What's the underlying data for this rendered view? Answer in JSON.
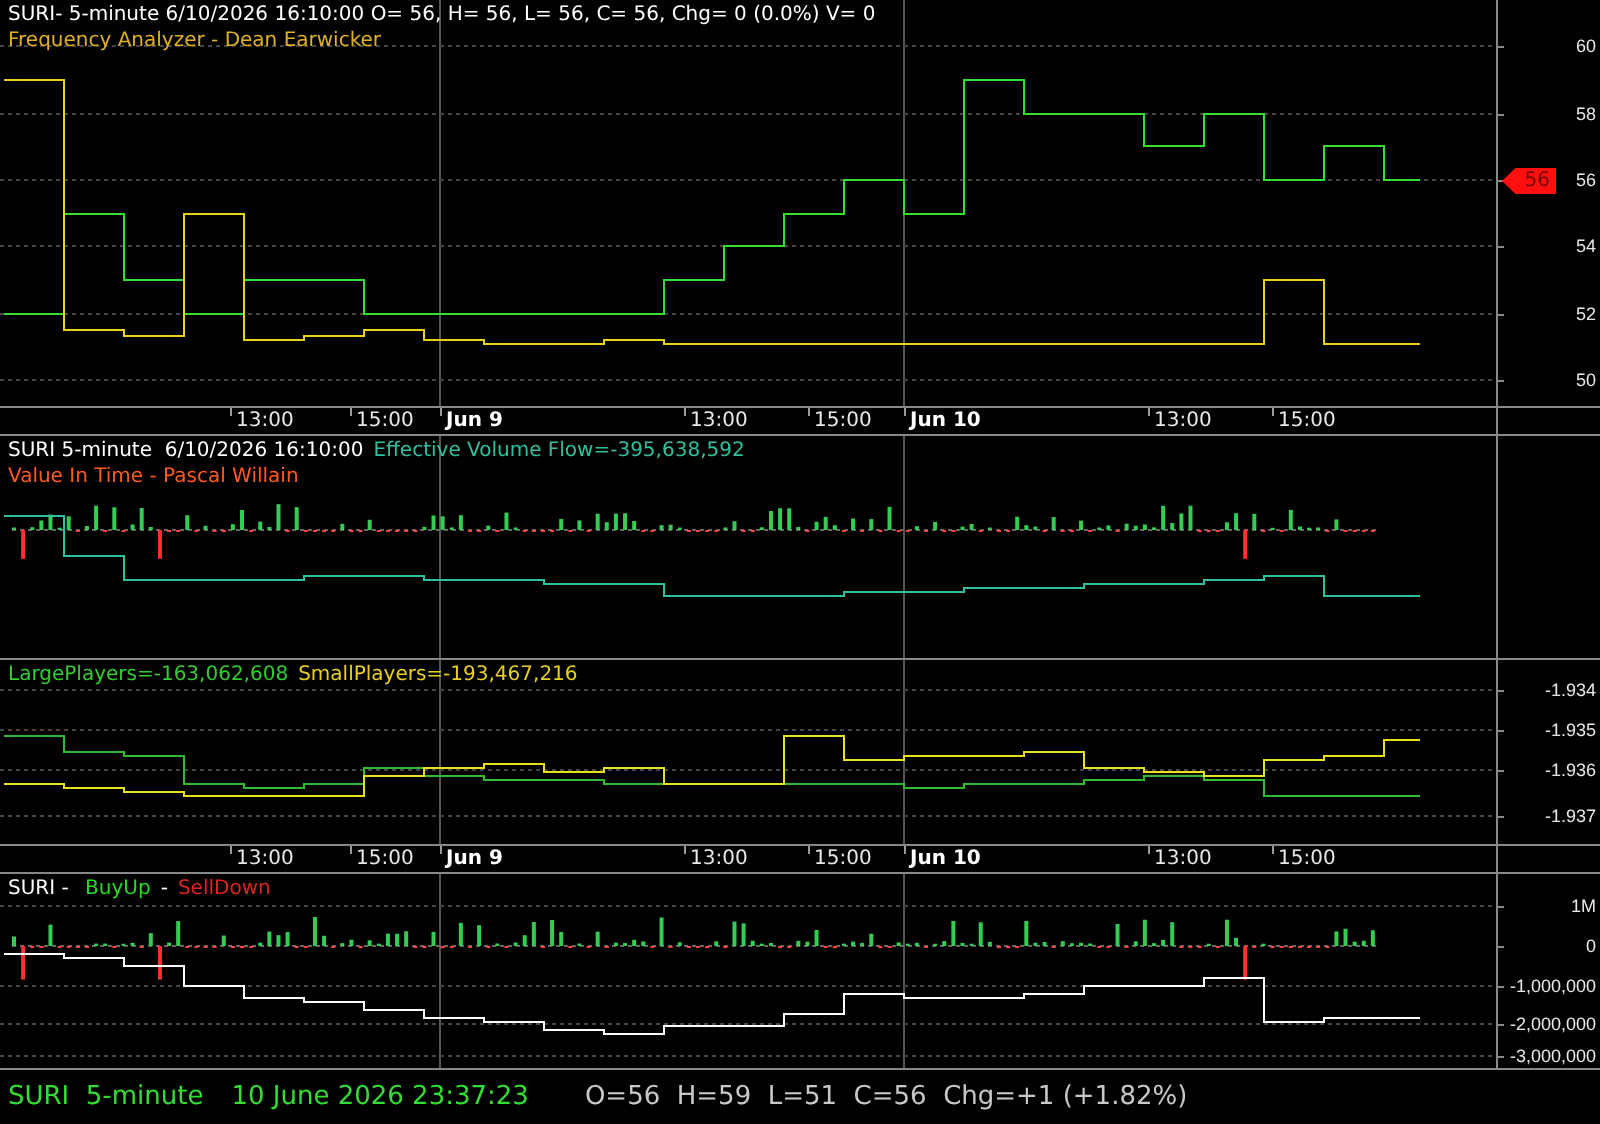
{
  "panels": [
    {
      "kind": "price",
      "header": [
        [
          {
            "text": "SURI- 5-minute 6/10/2026 16:10:00 O= 56, H= 56, L= 56, C= 56, Chg= 0 (0.0%) V= 0",
            "color": "#ffffff"
          }
        ],
        [
          {
            "text": "Frequency Analyzer - Dean Earwicker",
            "color": "#e0b020"
          }
        ]
      ],
      "y_axis": [
        "60",
        "58",
        "56",
        "54",
        "52",
        "50"
      ],
      "last_price": {
        "label": "56"
      },
      "time_axis": [
        {
          "label": "13:00",
          "bold": false
        },
        {
          "label": "15:00",
          "bold": false
        },
        {
          "label": "Jun 9",
          "bold": true
        },
        {
          "label": "13:00",
          "bold": false
        },
        {
          "label": "15:00",
          "bold": false
        },
        {
          "label": "Jun 10",
          "bold": true
        },
        {
          "label": "13:00",
          "bold": false
        },
        {
          "label": "15:00",
          "bold": false
        }
      ]
    },
    {
      "kind": "flow",
      "header": [
        [
          {
            "text": "SURI 5-minute  6/10/2026 16:10:00",
            "color": "#ffffff"
          },
          {
            "text": "Effective Volume Flow=-395,638,592",
            "color": "#30c0a0"
          }
        ],
        [
          {
            "text": "Value In Time - Pascal Willain",
            "color": "#ff5a1e"
          }
        ]
      ]
    },
    {
      "kind": "players",
      "header": [
        [
          {
            "text": "LargePlayers=-163,062,608",
            "color": "#33cc33"
          },
          {
            "text": "SmallPlayers=-193,467,216",
            "color": "#e8d020"
          }
        ]
      ],
      "y_axis": [
        "-1.934",
        "-1.935",
        "-1.936",
        "-1.937"
      ],
      "time_axis": [
        {
          "label": "13:00",
          "bold": false
        },
        {
          "label": "15:00",
          "bold": false
        },
        {
          "label": "Jun 9",
          "bold": true
        },
        {
          "label": "13:00",
          "bold": false
        },
        {
          "label": "15:00",
          "bold": false
        },
        {
          "label": "Jun 10",
          "bold": true
        },
        {
          "label": "13:00",
          "bold": false
        },
        {
          "label": "15:00",
          "bold": false
        }
      ]
    },
    {
      "kind": "buysell",
      "header": [
        [
          {
            "text": "SURI - ",
            "color": "#ffffff"
          },
          {
            "text": "BuyUp",
            "color": "#22dd22"
          },
          {
            "text": "-",
            "color": "#ffffff"
          },
          {
            "text": "SellDown",
            "color": "#dd2222"
          }
        ]
      ],
      "y_axis": [
        "1M",
        "0",
        "-1,000,000",
        "-2,000,000",
        "-3,000,000"
      ]
    }
  ],
  "status_bar": [
    {
      "text": "SURI  5-minute",
      "color": "#33dd33"
    },
    {
      "text": "10 June 2026 23:37:23",
      "color": "#33dd33"
    },
    {
      "text": "O=56  H=59  L=51  C=56  Chg=+1 (+1.82%)",
      "color": "#c8c8c8"
    }
  ]
}
